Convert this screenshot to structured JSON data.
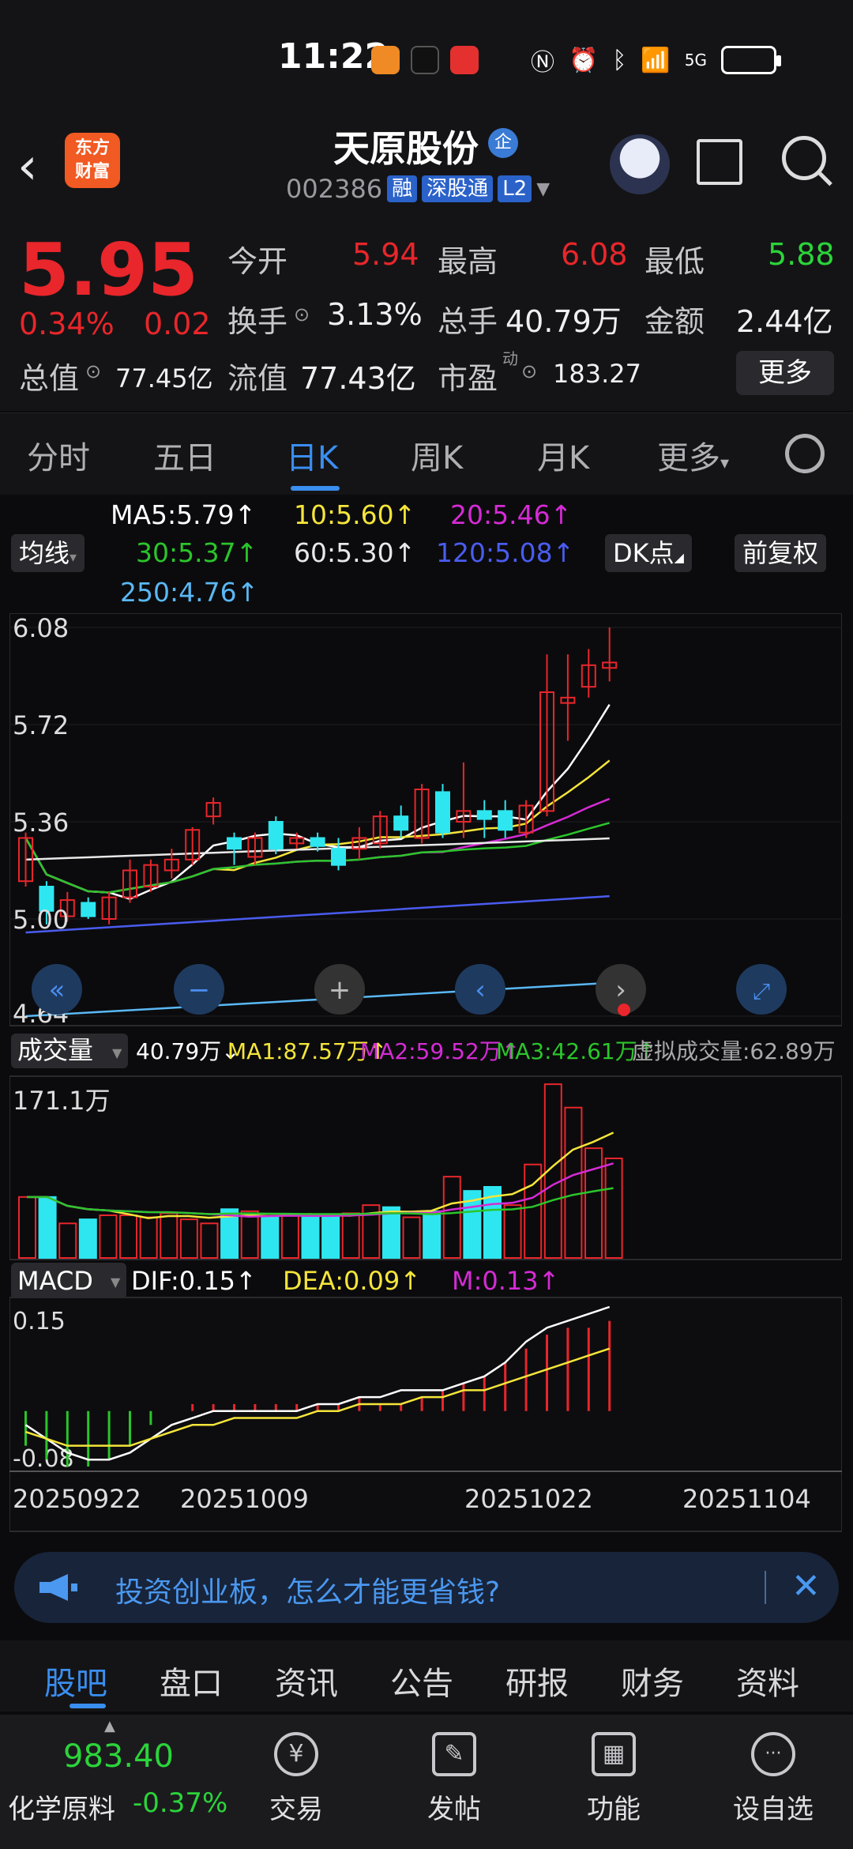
{
  "status_bar": {
    "time": "11:22",
    "battery_icon": "battery-charging-icon",
    "network": "5G"
  },
  "header": {
    "logo_text_1": "东方",
    "logo_text_2": "财富",
    "stock_name": "天原股份",
    "badge": "企",
    "code": "002386",
    "tags": [
      "融",
      "深股通",
      "L2"
    ]
  },
  "quote": {
    "price": "5.95",
    "pct": "0.34%",
    "change": "0.02",
    "open_label": "今开",
    "open": "5.94",
    "high_label": "最高",
    "high": "6.08",
    "low_label": "最低",
    "low": "5.88",
    "turnover_label": "换手",
    "turnover": "3.13%",
    "volume_label": "总手",
    "volume": "40.79万",
    "amount_label": "金额",
    "amount": "2.44亿",
    "total_cap_label": "总值",
    "total_cap": "77.45亿",
    "float_cap_label": "流值",
    "float_cap": "77.43亿",
    "pe_label": "市盈",
    "pe_sup": "动",
    "pe": "183.27",
    "more_label": "更多"
  },
  "period_tabs": [
    "分时",
    "五日",
    "日K",
    "周K",
    "月K",
    "更多"
  ],
  "active_period": "日K",
  "kline": {
    "ma_labels": {
      "ma5": "MA5:5.79↑",
      "ma10": "10:5.60↑",
      "ma20": "20:5.46↑",
      "ma30": "30:5.37↑",
      "ma60": "60:5.30↑",
      "ma120": "120:5.08↑",
      "ma250": "250:4.76↑"
    },
    "indicator_btn": "均线",
    "dk_btn": "DK点",
    "adjust_btn": "前复权",
    "y_ticks": [
      "6.08",
      "5.72",
      "5.36",
      "5.00",
      "4.64"
    ],
    "volume_header": "成交量",
    "volume_value": "40.79万↓",
    "vol_ma1": "MA1:87.57万↑",
    "vol_ma2": "MA2:59.52万↑",
    "vol_ma3": "MA3:42.61万↑",
    "virtual_volume": "虚拟成交量:62.89万",
    "vol_max": "171.1万",
    "macd_header": "MACD",
    "dif": "DIF:0.15↑",
    "dea": "DEA:0.09↑",
    "m": "M:0.13↑",
    "macd_ticks": [
      "0.15",
      "-0.08"
    ],
    "dates": [
      "20250922",
      "20251009",
      "20251022",
      "20251104"
    ]
  },
  "chart_data": {
    "type": "candlestick",
    "ylim": [
      4.64,
      6.08
    ],
    "candles": [
      {
        "o": 5.14,
        "c": 5.3,
        "h": 5.32,
        "l": 5.12
      },
      {
        "o": 5.12,
        "c": 5.03,
        "h": 5.14,
        "l": 4.98
      },
      {
        "o": 5.01,
        "c": 5.07,
        "h": 5.1,
        "l": 4.99
      },
      {
        "o": 5.06,
        "c": 5.01,
        "h": 5.08,
        "l": 5.0
      },
      {
        "o": 5.0,
        "c": 5.08,
        "h": 5.1,
        "l": 4.98
      },
      {
        "o": 5.08,
        "c": 5.18,
        "h": 5.22,
        "l": 5.06
      },
      {
        "o": 5.12,
        "c": 5.2,
        "h": 5.22,
        "l": 5.1
      },
      {
        "o": 5.18,
        "c": 5.22,
        "h": 5.26,
        "l": 5.15
      },
      {
        "o": 5.22,
        "c": 5.33,
        "h": 5.34,
        "l": 5.2
      },
      {
        "o": 5.38,
        "c": 5.43,
        "h": 5.45,
        "l": 5.35
      },
      {
        "o": 5.3,
        "c": 5.26,
        "h": 5.32,
        "l": 5.2
      },
      {
        "o": 5.23,
        "c": 5.3,
        "h": 5.32,
        "l": 5.2
      },
      {
        "o": 5.36,
        "c": 5.26,
        "h": 5.38,
        "l": 5.24
      },
      {
        "o": 5.28,
        "c": 5.3,
        "h": 5.32,
        "l": 5.26
      },
      {
        "o": 5.3,
        "c": 5.27,
        "h": 5.32,
        "l": 5.25
      },
      {
        "o": 5.26,
        "c": 5.2,
        "h": 5.3,
        "l": 5.18
      },
      {
        "o": 5.26,
        "c": 5.3,
        "h": 5.34,
        "l": 5.22
      },
      {
        "o": 5.28,
        "c": 5.38,
        "h": 5.4,
        "l": 5.26
      },
      {
        "o": 5.38,
        "c": 5.33,
        "h": 5.42,
        "l": 5.3
      },
      {
        "o": 5.3,
        "c": 5.48,
        "h": 5.5,
        "l": 5.28
      },
      {
        "o": 5.47,
        "c": 5.32,
        "h": 5.5,
        "l": 5.3
      },
      {
        "o": 5.36,
        "c": 5.4,
        "h": 5.58,
        "l": 5.3
      },
      {
        "o": 5.4,
        "c": 5.37,
        "h": 5.44,
        "l": 5.3
      },
      {
        "o": 5.4,
        "c": 5.33,
        "h": 5.44,
        "l": 5.3
      },
      {
        "o": 5.32,
        "c": 5.42,
        "h": 5.44,
        "l": 5.3
      },
      {
        "o": 5.4,
        "c": 5.84,
        "h": 5.98,
        "l": 5.38
      },
      {
        "o": 5.8,
        "c": 5.82,
        "h": 5.98,
        "l": 5.66
      },
      {
        "o": 5.86,
        "c": 5.94,
        "h": 6.0,
        "l": 5.82
      },
      {
        "o": 5.93,
        "c": 5.95,
        "h": 6.08,
        "l": 5.88
      }
    ],
    "volumes": [
      60,
      60,
      34,
      38,
      42,
      42,
      40,
      44,
      38,
      34,
      48,
      46,
      40,
      42,
      40,
      42,
      44,
      52,
      50,
      40,
      46,
      80,
      66,
      70,
      52,
      92,
      171,
      148,
      108,
      98
    ],
    "macd_bars": [
      -0.05,
      -0.07,
      -0.08,
      -0.08,
      -0.07,
      -0.05,
      -0.02,
      0.0,
      0.01,
      0.01,
      0.01,
      0.01,
      0.01,
      0.01,
      0.01,
      0.01,
      0.02,
      0.01,
      0.01,
      0.02,
      0.03,
      0.04,
      0.05,
      0.07,
      0.09,
      0.11,
      0.12,
      0.12,
      0.13
    ],
    "dif": [
      -0.02,
      -0.04,
      -0.06,
      -0.07,
      -0.07,
      -0.06,
      -0.04,
      -0.02,
      -0.01,
      0.0,
      0.0,
      0.0,
      0.0,
      0.0,
      0.01,
      0.01,
      0.02,
      0.02,
      0.03,
      0.03,
      0.03,
      0.04,
      0.05,
      0.07,
      0.1,
      0.12,
      0.13,
      0.14,
      0.15
    ],
    "dea": [
      -0.03,
      -0.04,
      -0.05,
      -0.05,
      -0.05,
      -0.05,
      -0.04,
      -0.03,
      -0.02,
      -0.02,
      -0.01,
      -0.01,
      -0.01,
      -0.01,
      0.0,
      0.0,
      0.01,
      0.01,
      0.01,
      0.02,
      0.02,
      0.03,
      0.03,
      0.04,
      0.05,
      0.06,
      0.07,
      0.08,
      0.09
    ]
  },
  "banner": {
    "text": "投资创业板，怎么才能更省钱?"
  },
  "bottom_tabs": [
    "股吧",
    "盘口",
    "资讯",
    "公告",
    "研报",
    "财务",
    "资料"
  ],
  "active_bottom_tab": "股吧",
  "dock": {
    "index_value": "983.40",
    "index_name": "化学原料",
    "index_pct": "-0.37%",
    "items": [
      {
        "label": "交易",
        "icon": "yen-trade-icon",
        "glyph": "¥"
      },
      {
        "label": "发帖",
        "icon": "edit-post-icon",
        "glyph": "✎"
      },
      {
        "label": "功能",
        "icon": "grid-function-icon",
        "glyph": "▦"
      },
      {
        "label": "设自选",
        "icon": "more-dots-icon",
        "glyph": "···"
      }
    ]
  }
}
